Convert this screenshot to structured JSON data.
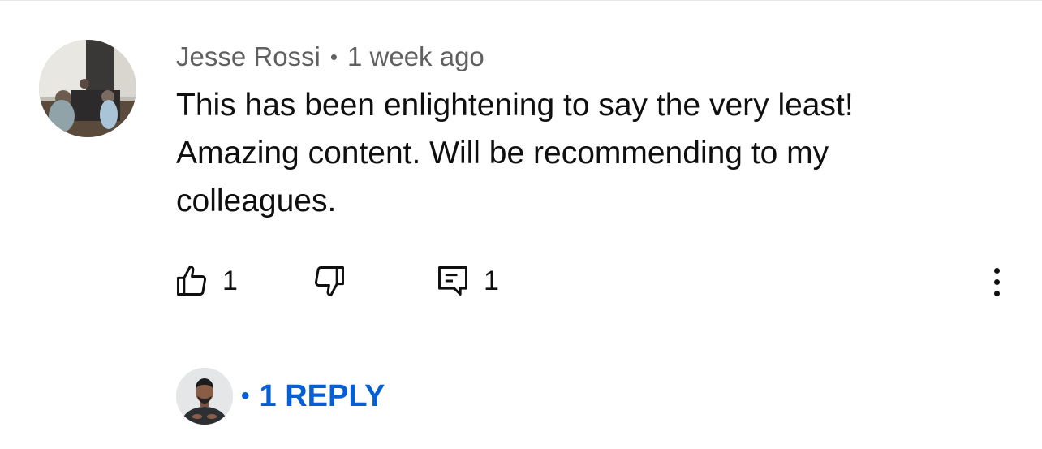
{
  "comment": {
    "author": "Jesse Rossi",
    "separator": "•",
    "time": "1 week ago",
    "text": "This has been enlightening to say the very least! Amazing content. Will be recommending to my colleagues.",
    "likes": "1",
    "replies_count": "1"
  },
  "replies_link": {
    "separator": "•",
    "label": "1 REPLY"
  },
  "icons": {
    "like": "thumbs-up-icon",
    "dislike": "thumbs-down-icon",
    "reply": "comment-reply-icon",
    "more": "more-vertical-icon"
  },
  "colors": {
    "link": "#065fd4",
    "meta_text": "#606060",
    "body_text": "#0f0f0f"
  }
}
